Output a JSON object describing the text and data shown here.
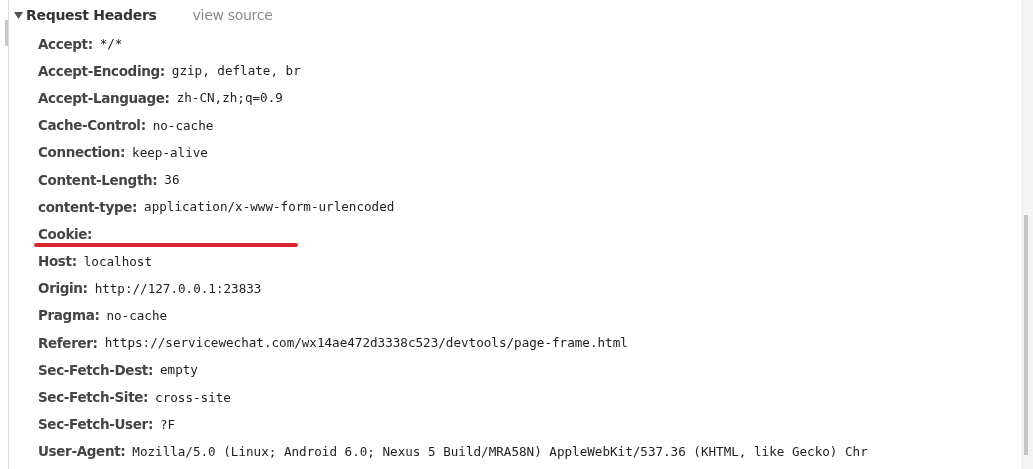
{
  "section": {
    "title": "Request Headers",
    "expanded": true,
    "link": "view source"
  },
  "headers": [
    {
      "name": "Accept:",
      "value": "*/*"
    },
    {
      "name": "Accept-Encoding:",
      "value": "gzip, deflate, br"
    },
    {
      "name": "Accept-Language:",
      "value": "zh-CN,zh;q=0.9"
    },
    {
      "name": "Cache-Control:",
      "value": "no-cache"
    },
    {
      "name": "Connection:",
      "value": "keep-alive"
    },
    {
      "name": "Content-Length:",
      "value": "36"
    },
    {
      "name": "content-type:",
      "value": "application/x-www-form-urlencoded"
    },
    {
      "name": "Cookie:",
      "underlined": true
    },
    {
      "name": "Host:",
      "value": "localhost"
    },
    {
      "name": "Origin:",
      "value": "http://127.0.0.1:23833"
    },
    {
      "name": "Pragma:",
      "value": "no-cache"
    },
    {
      "name": "Referer:",
      "value": "https://servicewechat.com/wx14ae472d3338c523/devtools/page-frame.html"
    },
    {
      "name": "Sec-Fetch-Dest:",
      "value": "empty"
    },
    {
      "name": "Sec-Fetch-Site:",
      "value": "cross-site"
    },
    {
      "name": "Sec-Fetch-User:",
      "value": "?F"
    },
    {
      "name": "User-Agent:",
      "value": "Mozilla/5.0 (Linux; Android 6.0; Nexus 5 Build/MRA58N) AppleWebKit/537.36 (KHTML, like Gecko) Chr"
    }
  ]
}
